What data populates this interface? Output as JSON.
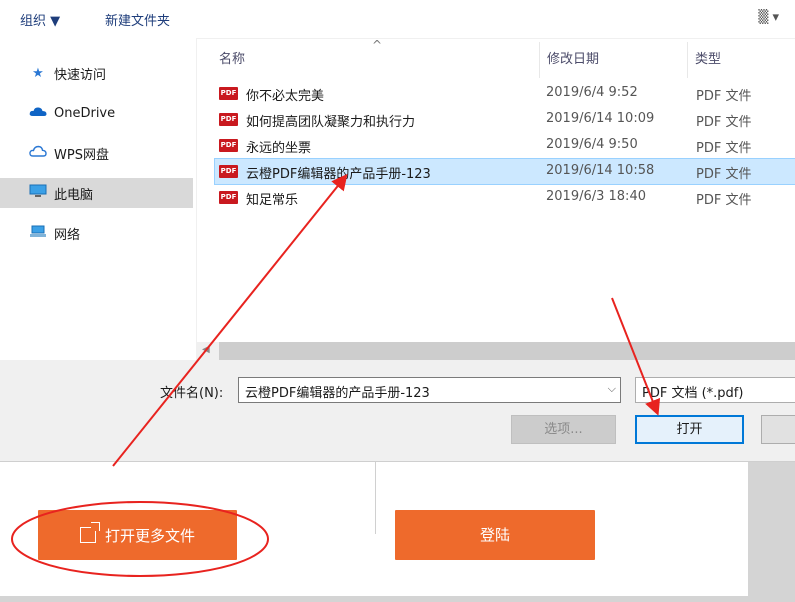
{
  "toolbar": {
    "organize": "组织 ▼",
    "new_folder": "新建文件夹",
    "view_icon": "▒ ▾"
  },
  "nav": {
    "items": [
      {
        "label": "快速访问",
        "icon": "star-icon"
      },
      {
        "label": "OneDrive",
        "icon": "cloud-icon"
      },
      {
        "label": "WPS网盘",
        "icon": "wps-cloud-icon"
      },
      {
        "label": "此电脑",
        "icon": "computer-icon"
      },
      {
        "label": "网络",
        "icon": "network-icon"
      }
    ]
  },
  "columns": {
    "name": "名称",
    "date": "修改日期",
    "type": "类型"
  },
  "files": [
    {
      "name": "你不必太完美",
      "date": "2019/6/4 9:52",
      "type": "PDF 文件"
    },
    {
      "name": "如何提高团队凝聚力和执行力",
      "date": "2019/6/14 10:09",
      "type": "PDF 文件"
    },
    {
      "name": "永远的坐票",
      "date": "2019/6/4 9:50",
      "type": "PDF 文件"
    },
    {
      "name": "云橙PDF编辑器的产品手册-123",
      "date": "2019/6/14 10:58",
      "type": "PDF 文件"
    },
    {
      "name": "知足常乐",
      "date": "2019/6/3 18:40",
      "type": "PDF 文件"
    }
  ],
  "pdf_badge": "PDF",
  "filename": {
    "label": "文件名(N):",
    "value": "云橙PDF编辑器的产品手册-123"
  },
  "filter": {
    "value": "PDF 文档 (*.pdf)"
  },
  "buttons": {
    "options": "选项...",
    "open": "打开"
  },
  "app": {
    "open_more": "打开更多文件",
    "login": "登陆"
  },
  "colors": {
    "accent": "#ee6a2c",
    "annotation": "#e8231f",
    "selection": "#cce8ff",
    "pdf_icon": "#c9191f"
  }
}
